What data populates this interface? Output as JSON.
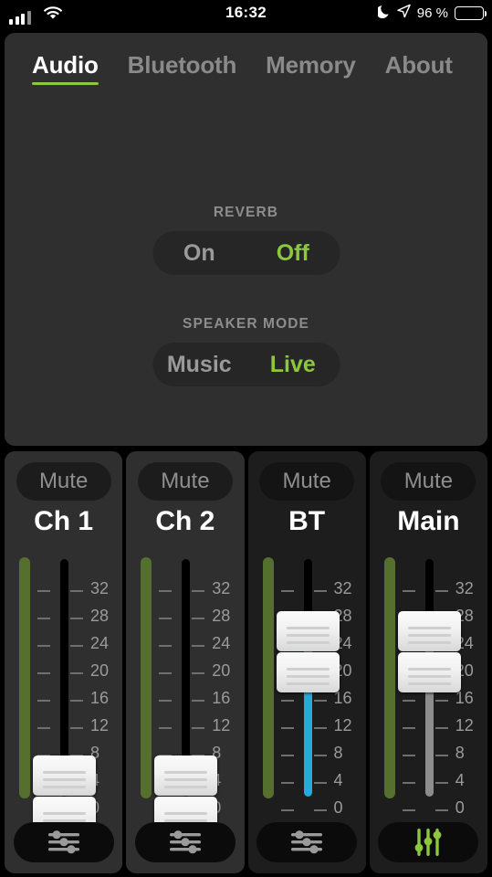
{
  "status_bar": {
    "time": "16:32",
    "battery_text": "96 %",
    "battery_level": 96,
    "icons": [
      "signal-bars-icon",
      "wifi-icon",
      "do-not-disturb-moon-icon",
      "location-arrow-icon",
      "battery-icon"
    ]
  },
  "tabs": [
    {
      "label": "Audio",
      "active": true
    },
    {
      "label": "Bluetooth",
      "active": false
    },
    {
      "label": "Memory",
      "active": false
    },
    {
      "label": "About",
      "active": false
    }
  ],
  "settings": {
    "reverb": {
      "label": "REVERB",
      "options": [
        "On",
        "Off"
      ],
      "selected": "Off"
    },
    "speaker_mode": {
      "label": "SPEAKER MODE",
      "options": [
        "Music",
        "Live"
      ],
      "selected": "Live"
    }
  },
  "scale_ticks": [
    "32",
    "28",
    "24",
    "20",
    "16",
    "12",
    "8",
    "4",
    "0"
  ],
  "channels": [
    {
      "name": "Ch 1",
      "mute_label": "Mute",
      "muted": false,
      "meter_level": 100,
      "fader_value": 5,
      "track_fill": "none",
      "eq_icon": "horizontal-sliders-icon",
      "eq_active": false
    },
    {
      "name": "Ch 2",
      "mute_label": "Mute",
      "muted": false,
      "meter_level": 100,
      "fader_value": 5,
      "track_fill": "none",
      "eq_icon": "horizontal-sliders-icon",
      "eq_active": false
    },
    {
      "name": "BT",
      "mute_label": "Mute",
      "muted": false,
      "meter_level": 100,
      "fader_value": 26,
      "track_fill": "blue",
      "eq_icon": "horizontal-sliders-icon",
      "eq_active": false
    },
    {
      "name": "Main",
      "mute_label": "Mute",
      "muted": false,
      "meter_level": 100,
      "fader_value": 26,
      "track_fill": "gray",
      "eq_icon": "vertical-sliders-icon",
      "eq_active": true
    }
  ],
  "colors": {
    "accent_green": "#8dc63f",
    "meter_green": "#55702e",
    "fill_blue": "#29a8dc",
    "fill_gray": "#8d8d8d",
    "panel_bg": "#2f2f2f",
    "strip_dark_bg": "#1d1d1d"
  }
}
